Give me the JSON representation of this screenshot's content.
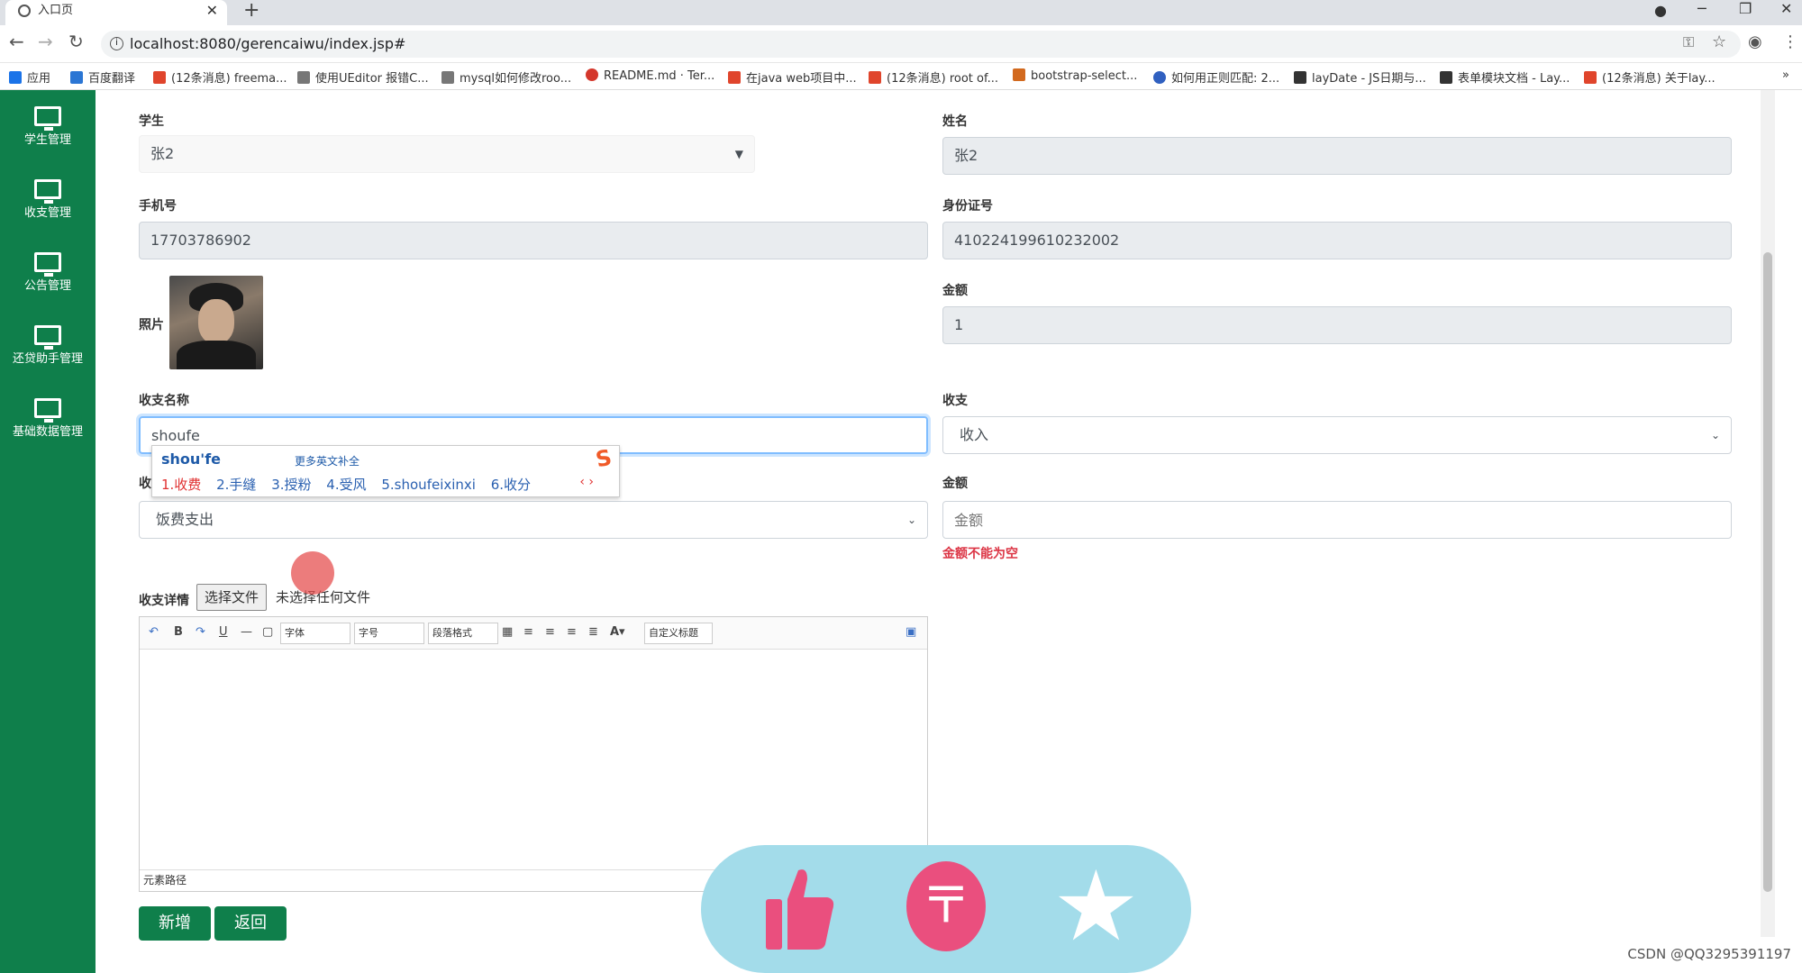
{
  "browser": {
    "tab_title": "入口页",
    "url": "localhost:8080/gerencaiwu/index.jsp#",
    "bookmarks": [
      "应用",
      "百度翻译",
      "(12条消息) freema...",
      "使用UEditor 报错C...",
      "mysql如何修改roo...",
      "README.md · Ter...",
      "在java web项目中...",
      "(12条消息) root of...",
      "bootstrap-select...",
      "如何用正则匹配: 2...",
      "layDate - JS日期与...",
      "表单模块文档 - Lay...",
      "(12条消息) 关于lay..."
    ]
  },
  "sidebar": {
    "items": [
      {
        "label": "学生管理",
        "icon": "monitor-icon"
      },
      {
        "label": "收支管理",
        "icon": "monitor-icon"
      },
      {
        "label": "公告管理",
        "icon": "monitor-icon"
      },
      {
        "label": "还贷助手管理",
        "icon": "monitor-icon"
      },
      {
        "label": "基础数据管理",
        "icon": "monitor-icon"
      }
    ]
  },
  "form": {
    "student_label": "学生",
    "student_value": "张2",
    "name_label": "姓名",
    "name_value": "张2",
    "phone_label": "手机号",
    "phone_value": "17703786902",
    "idcard_label": "身份证号",
    "idcard_value": "410224199610232002",
    "photo_label": "照片",
    "amount1_label": "金额",
    "amount1_value": "1",
    "item_name_label": "收支名称",
    "item_name_value": "shoufe",
    "type_label": "收支",
    "type_value": "收入",
    "category_label": "收",
    "category_value": "饭费支出",
    "amount2_label": "金额",
    "amount2_placeholder": "金额",
    "amount2_error": "金额不能为空",
    "detail_label": "收支详情",
    "file_button": "选择文件",
    "file_status": "未选择任何文件",
    "add_button": "新增",
    "back_button": "返回"
  },
  "ime": {
    "composition": "shou'fe",
    "more": "更多英文补全",
    "candidates": [
      "1.收费",
      "2.手缝",
      "3.授粉",
      "4.受风",
      "5.shoufeixinxi",
      "6.收分"
    ]
  },
  "editor": {
    "font_select": "字体",
    "size_select": "字号",
    "paragraph_select": "段落格式",
    "custom_title": "自定义标题",
    "footer": "元素路径"
  },
  "watermark": "CSDN @QQ3295391197"
}
